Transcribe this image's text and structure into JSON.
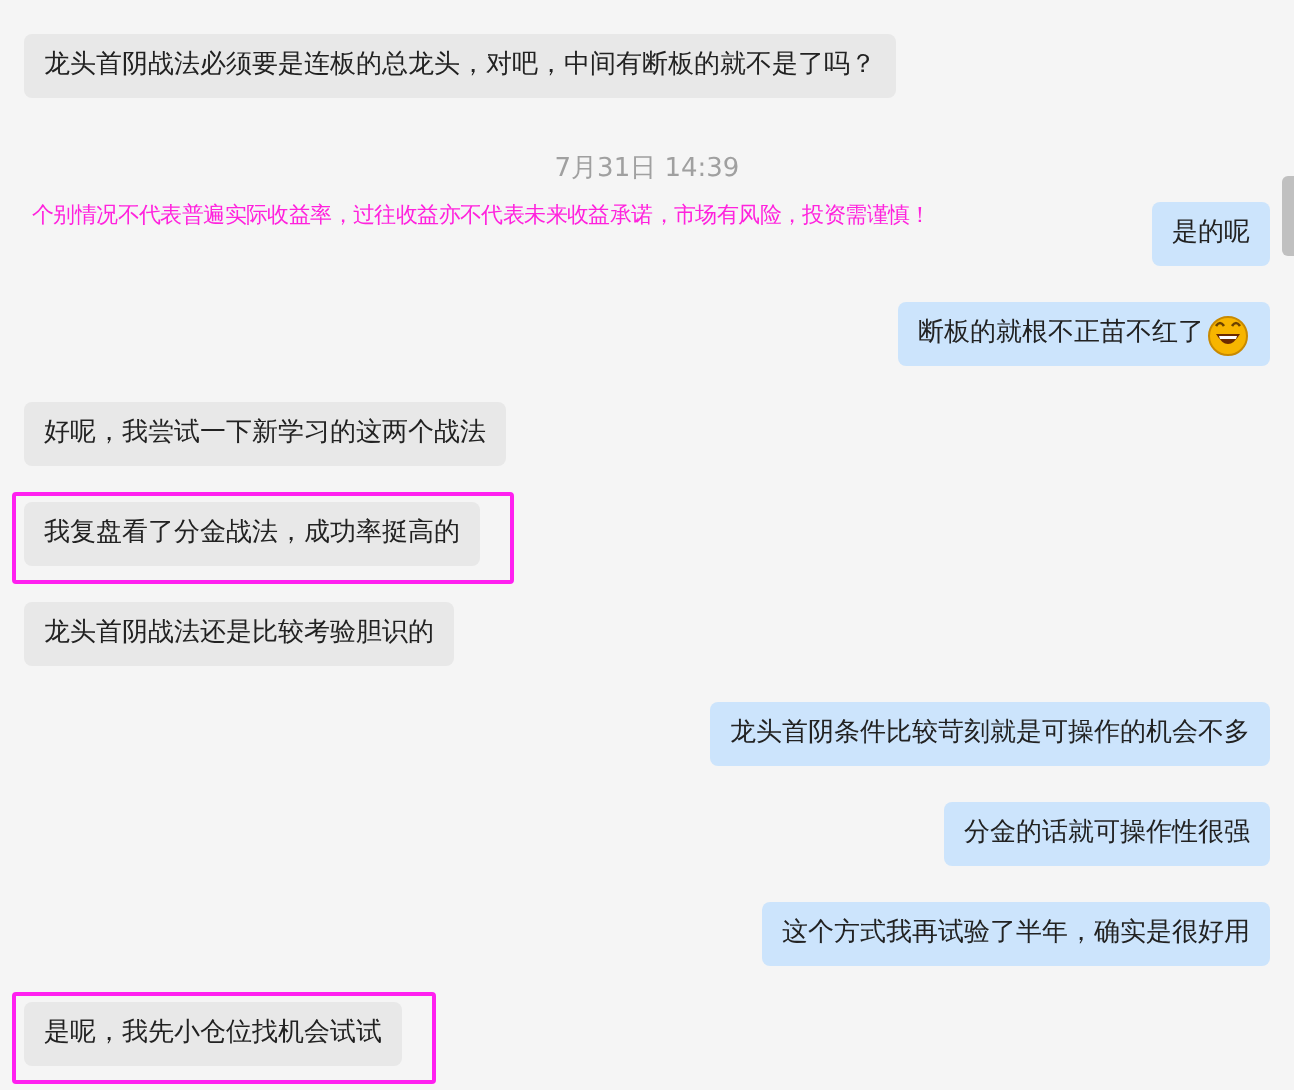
{
  "messages": [
    {
      "kind": "received",
      "text": "龙头首阴战法必须要是连板的总龙头，对吧，中间有断板的就不是了吗？",
      "highlighted": false
    },
    {
      "kind": "time",
      "text": "7月31日 14:39"
    },
    {
      "kind": "sent",
      "text": "是的呢",
      "highlighted": false,
      "notice": "个别情况不代表普遍实际收益率，过往收益亦不代表未来收益承诺，市场有风险，投资需谨慎！"
    },
    {
      "kind": "sent",
      "text": "断板的就根不正苗不红了",
      "highlighted": false,
      "emoji": true
    },
    {
      "kind": "received",
      "text": "好呢，我尝试一下新学习的这两个战法",
      "highlighted": false
    },
    {
      "kind": "received",
      "text": "我复盘看了分金战法，成功率挺高的",
      "highlighted": true
    },
    {
      "kind": "received",
      "text": "龙头首阴战法还是比较考验胆识的",
      "highlighted": false
    },
    {
      "kind": "sent",
      "text": "龙头首阴条件比较苛刻就是可操作的机会不多",
      "highlighted": false
    },
    {
      "kind": "sent",
      "text": "分金的话就可操作性很强",
      "highlighted": false
    },
    {
      "kind": "sent",
      "text": "这个方式我再试验了半年，确实是很好用",
      "highlighted": false
    },
    {
      "kind": "received",
      "text": "是呢，我先小仓位找机会试试",
      "highlighted": true
    }
  ]
}
